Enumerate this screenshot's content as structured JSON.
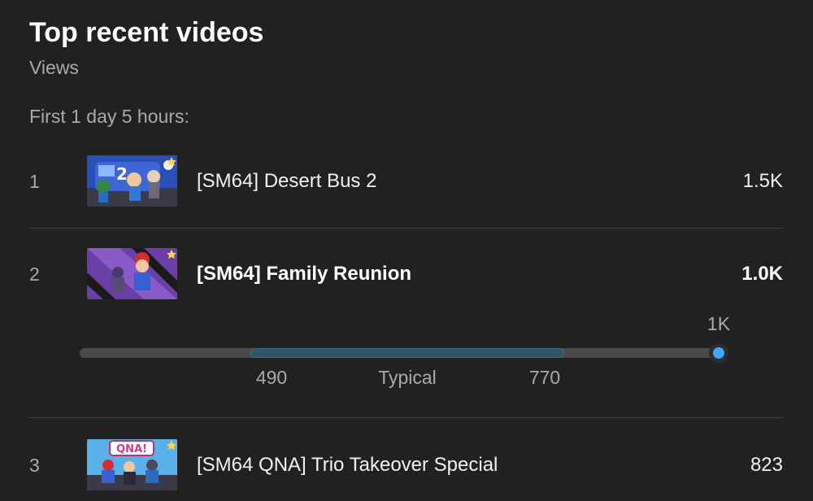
{
  "header": {
    "title": "Top recent videos",
    "metric": "Views",
    "period": "First 1 day 5 hours:"
  },
  "videos": [
    {
      "rank": "1",
      "title": "[SM64] Desert Bus 2",
      "views": "1.5K",
      "thumbnail": "thumbnail-desert-bus-2"
    },
    {
      "rank": "2",
      "title": "[SM64] Family Reunion",
      "views": "1.0K",
      "thumbnail": "thumbnail-family-reunion"
    },
    {
      "rank": "3",
      "title": "[SM64 QNA] Trio Takeover Special",
      "views": "823",
      "thumbnail": "thumbnail-trio-takeover"
    }
  ],
  "typical_range": {
    "label": "Typical",
    "low_label": "490",
    "high_label": "770",
    "current_label": "1K",
    "low": 490,
    "high": 770,
    "current": 1000,
    "scale_min": 0,
    "scale_max": 1000
  },
  "colors": {
    "background": "#212121",
    "accent": "#3ea6ff",
    "typical_band": "#2f5566",
    "muted_text": "#aaaaaa"
  }
}
